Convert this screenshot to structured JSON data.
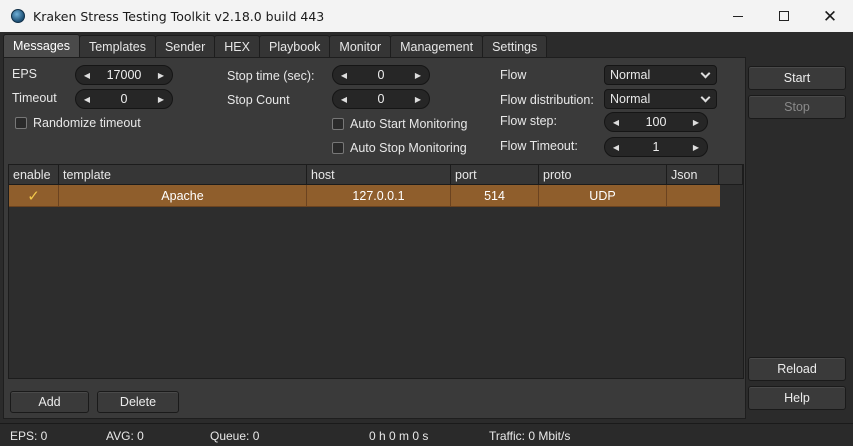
{
  "window": {
    "title": "Kraken Stress Testing Toolkit v2.18.0 build 443",
    "minimize_glyph": "",
    "maximize_glyph": "",
    "close_glyph": "✕"
  },
  "tabs": [
    {
      "label": "Messages",
      "active": true
    },
    {
      "label": "Templates"
    },
    {
      "label": "Sender"
    },
    {
      "label": "HEX"
    },
    {
      "label": "Playbook"
    },
    {
      "label": "Monitor"
    },
    {
      "label": "Management"
    },
    {
      "label": "Settings"
    }
  ],
  "settings": {
    "eps_label": "EPS",
    "eps_value": "17000",
    "timeout_label": "Timeout",
    "timeout_value": "0",
    "randomize_timeout_label": "Randomize timeout",
    "stop_time_label": "Stop time (sec):",
    "stop_time_value": "0",
    "stop_count_label": "Stop Count",
    "stop_count_value": "0",
    "auto_start_monitoring_label": "Auto Start Monitoring",
    "auto_stop_monitoring_label": "Auto Stop Monitoring",
    "flow_label": "Flow",
    "flow_value": "Normal",
    "flow_distribution_label": "Flow distribution:",
    "flow_distribution_value": "Normal",
    "flow_step_label": "Flow step:",
    "flow_step_value": "100",
    "flow_timeout_label": "Flow Timeout:",
    "flow_timeout_value": "1"
  },
  "table": {
    "columns": [
      "enable",
      "template",
      "host",
      "port",
      "proto",
      "Json"
    ],
    "rows": [
      {
        "enable_glyph": "✓",
        "template": "Apache",
        "host": "127.0.0.1",
        "port": "514",
        "proto": "UDP",
        "json": ""
      }
    ]
  },
  "buttons": {
    "add": "Add",
    "delete": "Delete",
    "start": "Start",
    "stop": "Stop",
    "reload": "Reload",
    "help": "Help"
  },
  "status": {
    "eps": "EPS: 0",
    "avg": "AVG: 0",
    "queue": "Queue: 0",
    "elapsed": "0 h 0 m 0 s",
    "traffic": "Traffic: 0 Mbit/s"
  },
  "colors": {
    "selected_row": "#8f5e2c",
    "check_mark": "#f2c84b",
    "background": "#2b2b2b"
  }
}
